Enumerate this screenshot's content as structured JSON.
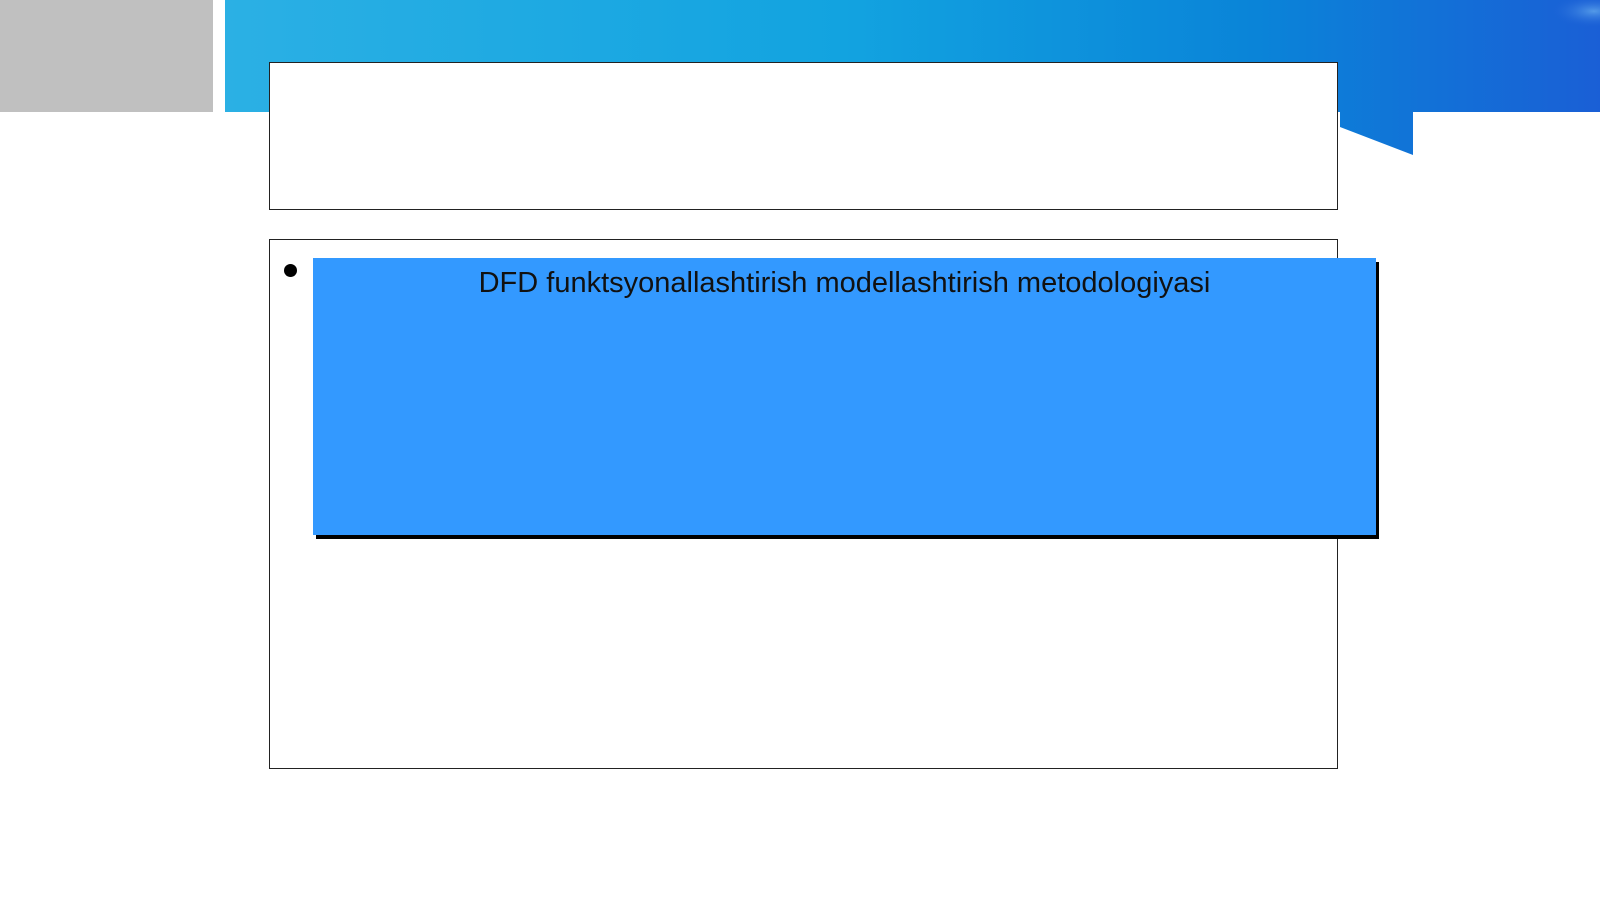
{
  "slide": {
    "title": "",
    "content": {
      "card_text": "DFD funktsyonallashtirish modellashtirish metodologiyasi"
    }
  },
  "colors": {
    "banner_light": "#29aee6",
    "banner_dark": "#1a5fd6",
    "gray_block": "#c0c0c0",
    "card_fill": "#3399ff",
    "card_shadow": "#000000"
  }
}
